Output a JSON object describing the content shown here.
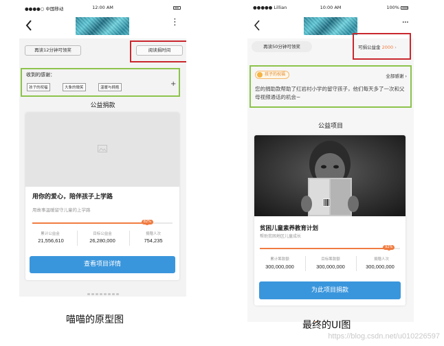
{
  "left": {
    "status": {
      "carrier": "●●●●○ 中国移动",
      "time": "12:00 AM"
    },
    "read_reward": "再读12分钟可领奖",
    "reading_time": "阅读捐时间",
    "thanks_title": "收到的感谢：",
    "tags": [
      "孩子的祝福",
      "大象的微笑",
      "温暖与拥抱"
    ],
    "plus": "+",
    "section_title": "公益捐款",
    "card": {
      "title": "用你的爱心，陪伴孩子上学路",
      "subtitle": "用故事温暖留守儿童的上学路",
      "progress": 0.82,
      "progress_label": "82%",
      "stats": [
        {
          "label": "累计公益金",
          "value": "21,556,610"
        },
        {
          "label": "目标公益金",
          "value": "26,280,000"
        },
        {
          "label": "捐赠人次",
          "value": "754,235"
        }
      ],
      "button": "查看项目详情"
    },
    "caption": "喵喵的原型图"
  },
  "right": {
    "status": {
      "carrier": "●●●●● Lillian",
      "time": "10:00 AM",
      "battery": "100%"
    },
    "read_reward": "再读50分钟可领奖",
    "donatable_label": "可捐公益金",
    "donatable_value": "2000",
    "donatable_arrow": "›",
    "badge": "孩子的祝福",
    "all_thanks": "全部感谢 ›",
    "thanks_text": "您的捐助款帮助了红岩村小学的留守孩子，他们每天多了一次和父母视频通话的机会~",
    "section_title": "公益项目",
    "card": {
      "title": "贫困儿童素养教育计划",
      "subtitle": "帮助贫困地区儿童成长",
      "progress": 0.92,
      "progress_label": "92%",
      "stats": [
        {
          "label": "累计筹款额",
          "value": "300,000,000"
        },
        {
          "label": "目标筹款额",
          "value": "300,000,000"
        },
        {
          "label": "捐赠人次",
          "value": "300,000,000"
        }
      ],
      "button": "为此项目捐款"
    },
    "caption": "最终的UI图"
  },
  "watermark": "https://blog.csdn.net/u010226597",
  "colors": {
    "accent": "#f07b3f",
    "primary": "#3a96dc",
    "highlight_red": "#c9262c",
    "highlight_green": "#8bc34a"
  }
}
